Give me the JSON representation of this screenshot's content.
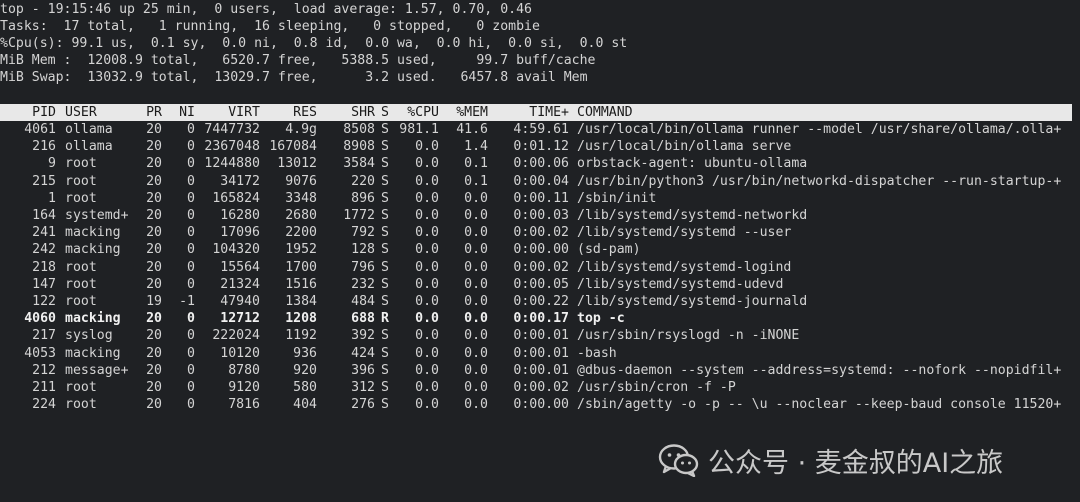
{
  "summary": [
    "top - 19:15:46 up 25 min,  0 users,  load average: 1.57, 0.70, 0.46",
    "Tasks:  17 total,   1 running,  16 sleeping,   0 stopped,   0 zombie",
    "%Cpu(s): 99.1 us,  0.1 sy,  0.0 ni,  0.8 id,  0.0 wa,  0.0 hi,  0.0 si,  0.0 st",
    "MiB Mem :  12008.9 total,   6520.7 free,   5388.5 used,     99.7 buff/cache",
    "MiB Swap:  13032.9 total,  13029.7 free,      3.2 used.   6457.8 avail Mem"
  ],
  "columns": [
    "PID",
    "USER",
    "PR",
    "NI",
    "VIRT",
    "RES",
    "SHR",
    "S",
    "%CPU",
    "%MEM",
    "TIME+",
    "COMMAND"
  ],
  "processes": [
    {
      "pid": "4061",
      "user": "ollama",
      "pr": "20",
      "ni": "0",
      "virt": "7447732",
      "res": "4.9g",
      "shr": "8508",
      "s": "S",
      "cpu": "981.1",
      "mem": "41.6",
      "time": "4:59.61",
      "command": "/usr/local/bin/ollama runner --model /usr/share/ollama/.olla+",
      "bold": false
    },
    {
      "pid": "216",
      "user": "ollama",
      "pr": "20",
      "ni": "0",
      "virt": "2367048",
      "res": "167084",
      "shr": "8908",
      "s": "S",
      "cpu": "0.0",
      "mem": "1.4",
      "time": "0:01.12",
      "command": "/usr/local/bin/ollama serve",
      "bold": false
    },
    {
      "pid": "9",
      "user": "root",
      "pr": "20",
      "ni": "0",
      "virt": "1244880",
      "res": "13012",
      "shr": "3584",
      "s": "S",
      "cpu": "0.0",
      "mem": "0.1",
      "time": "0:00.06",
      "command": "orbstack-agent: ubuntu-ollama",
      "bold": false
    },
    {
      "pid": "215",
      "user": "root",
      "pr": "20",
      "ni": "0",
      "virt": "34172",
      "res": "9076",
      "shr": "220",
      "s": "S",
      "cpu": "0.0",
      "mem": "0.1",
      "time": "0:00.04",
      "command": "/usr/bin/python3 /usr/bin/networkd-dispatcher --run-startup-+",
      "bold": false
    },
    {
      "pid": "1",
      "user": "root",
      "pr": "20",
      "ni": "0",
      "virt": "165824",
      "res": "3348",
      "shr": "896",
      "s": "S",
      "cpu": "0.0",
      "mem": "0.0",
      "time": "0:00.11",
      "command": "/sbin/init",
      "bold": false
    },
    {
      "pid": "164",
      "user": "systemd+",
      "pr": "20",
      "ni": "0",
      "virt": "16280",
      "res": "2680",
      "shr": "1772",
      "s": "S",
      "cpu": "0.0",
      "mem": "0.0",
      "time": "0:00.03",
      "command": "/lib/systemd/systemd-networkd",
      "bold": false
    },
    {
      "pid": "241",
      "user": "macking",
      "pr": "20",
      "ni": "0",
      "virt": "17096",
      "res": "2200",
      "shr": "792",
      "s": "S",
      "cpu": "0.0",
      "mem": "0.0",
      "time": "0:00.02",
      "command": "/lib/systemd/systemd --user",
      "bold": false
    },
    {
      "pid": "242",
      "user": "macking",
      "pr": "20",
      "ni": "0",
      "virt": "104320",
      "res": "1952",
      "shr": "128",
      "s": "S",
      "cpu": "0.0",
      "mem": "0.0",
      "time": "0:00.00",
      "command": "(sd-pam)",
      "bold": false
    },
    {
      "pid": "218",
      "user": "root",
      "pr": "20",
      "ni": "0",
      "virt": "15564",
      "res": "1700",
      "shr": "796",
      "s": "S",
      "cpu": "0.0",
      "mem": "0.0",
      "time": "0:00.02",
      "command": "/lib/systemd/systemd-logind",
      "bold": false
    },
    {
      "pid": "147",
      "user": "root",
      "pr": "20",
      "ni": "0",
      "virt": "21324",
      "res": "1516",
      "shr": "232",
      "s": "S",
      "cpu": "0.0",
      "mem": "0.0",
      "time": "0:00.05",
      "command": "/lib/systemd/systemd-udevd",
      "bold": false
    },
    {
      "pid": "122",
      "user": "root",
      "pr": "19",
      "ni": "-1",
      "virt": "47940",
      "res": "1384",
      "shr": "484",
      "s": "S",
      "cpu": "0.0",
      "mem": "0.0",
      "time": "0:00.22",
      "command": "/lib/systemd/systemd-journald",
      "bold": false
    },
    {
      "pid": "4060",
      "user": "macking",
      "pr": "20",
      "ni": "0",
      "virt": "12712",
      "res": "1208",
      "shr": "688",
      "s": "R",
      "cpu": "0.0",
      "mem": "0.0",
      "time": "0:00.17",
      "command": "top -c",
      "bold": true
    },
    {
      "pid": "217",
      "user": "syslog",
      "pr": "20",
      "ni": "0",
      "virt": "222024",
      "res": "1192",
      "shr": "392",
      "s": "S",
      "cpu": "0.0",
      "mem": "0.0",
      "time": "0:00.01",
      "command": "/usr/sbin/rsyslogd -n -iNONE",
      "bold": false
    },
    {
      "pid": "4053",
      "user": "macking",
      "pr": "20",
      "ni": "0",
      "virt": "10120",
      "res": "936",
      "shr": "424",
      "s": "S",
      "cpu": "0.0",
      "mem": "0.0",
      "time": "0:00.01",
      "command": "-bash",
      "bold": false
    },
    {
      "pid": "212",
      "user": "message+",
      "pr": "20",
      "ni": "0",
      "virt": "8780",
      "res": "920",
      "shr": "396",
      "s": "S",
      "cpu": "0.0",
      "mem": "0.0",
      "time": "0:00.01",
      "command": "@dbus-daemon --system --address=systemd: --nofork --nopidfil+",
      "bold": false
    },
    {
      "pid": "211",
      "user": "root",
      "pr": "20",
      "ni": "0",
      "virt": "9120",
      "res": "580",
      "shr": "312",
      "s": "S",
      "cpu": "0.0",
      "mem": "0.0",
      "time": "0:00.02",
      "command": "/usr/sbin/cron -f -P",
      "bold": false
    },
    {
      "pid": "224",
      "user": "root",
      "pr": "20",
      "ni": "0",
      "virt": "7816",
      "res": "404",
      "shr": "276",
      "s": "S",
      "cpu": "0.0",
      "mem": "0.0",
      "time": "0:00.00",
      "command": "/sbin/agetty -o -p -- \\u --noclear --keep-baud console 11520+",
      "bold": false
    }
  ],
  "watermark": {
    "icon": "wechat-icon",
    "text": "公众号 · 麦金叔的AI之旅"
  },
  "colors": {
    "background": "#1f2124",
    "foreground": "#d4d4d4",
    "header_bg": "#e8e8e8",
    "header_fg": "#1a1a1a"
  }
}
